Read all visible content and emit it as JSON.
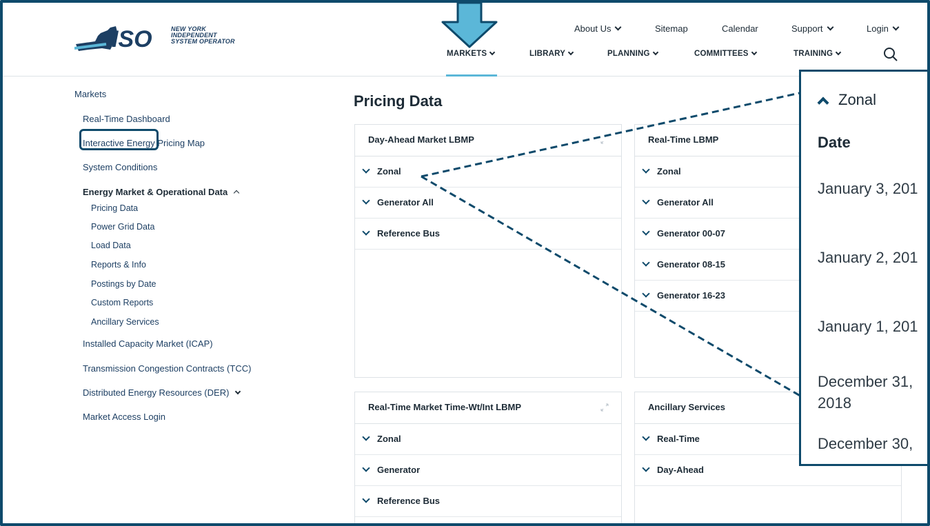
{
  "logo": {
    "mark": "ISO",
    "line1": "NEW YORK",
    "line2": "INDEPENDENT",
    "line3": "SYSTEM OPERATOR"
  },
  "util_nav": {
    "about": "About Us",
    "sitemap": "Sitemap",
    "calendar": "Calendar",
    "support": "Support",
    "login": "Login"
  },
  "main_nav": {
    "markets": "MARKETS",
    "library": "LIBRARY",
    "planning": "PLANNING",
    "committees": "COMMITTEES",
    "training": "TRAINING"
  },
  "sidebar": {
    "root": "Markets",
    "realtime_dashboard": "Real-Time Dashboard",
    "pricing_map": "Interactive Energy Pricing Map",
    "system_conditions": "System Conditions",
    "energy_market": "Energy Market & Operational Data",
    "sub": [
      "Pricing Data",
      "Power Grid Data",
      "Load Data",
      "Reports & Info",
      "Postings by Date",
      "Custom Reports",
      "Ancillary Services"
    ],
    "icap": "Installed Capacity Market (ICAP)",
    "tcc": "Transmission Congestion Contracts (TCC)",
    "der": "Distributed Energy Resources (DER)",
    "access_login": "Market Access Login"
  },
  "page_title": "Pricing Data",
  "panels": {
    "dam": {
      "title": "Day-Ahead Market LBMP",
      "rows": [
        "Zonal",
        "Generator All",
        "Reference Bus"
      ]
    },
    "rt": {
      "title": "Real-Time LBMP",
      "rows": [
        "Zonal",
        "Generator All",
        "Generator 00-07",
        "Generator 08-15",
        "Generator 16-23"
      ]
    },
    "rtw": {
      "title": "Real-Time Market Time-Wt/Int LBMP",
      "rows": [
        "Zonal",
        "Generator",
        "Reference Bus"
      ]
    },
    "anc": {
      "title": "Ancillary Services",
      "rows": [
        "Real-Time",
        "Day-Ahead"
      ]
    }
  },
  "zoom": {
    "heading": "Zonal",
    "date_header": "Date",
    "rows": [
      "January 3, 201",
      "January 2, 201",
      "January 1, 201",
      "December 31,",
      "2018",
      "December 30,"
    ]
  },
  "colors": {
    "accent": "#0e4a6b",
    "arrow": "#5bb7d8",
    "nav_underline": "#5bb7d8"
  }
}
